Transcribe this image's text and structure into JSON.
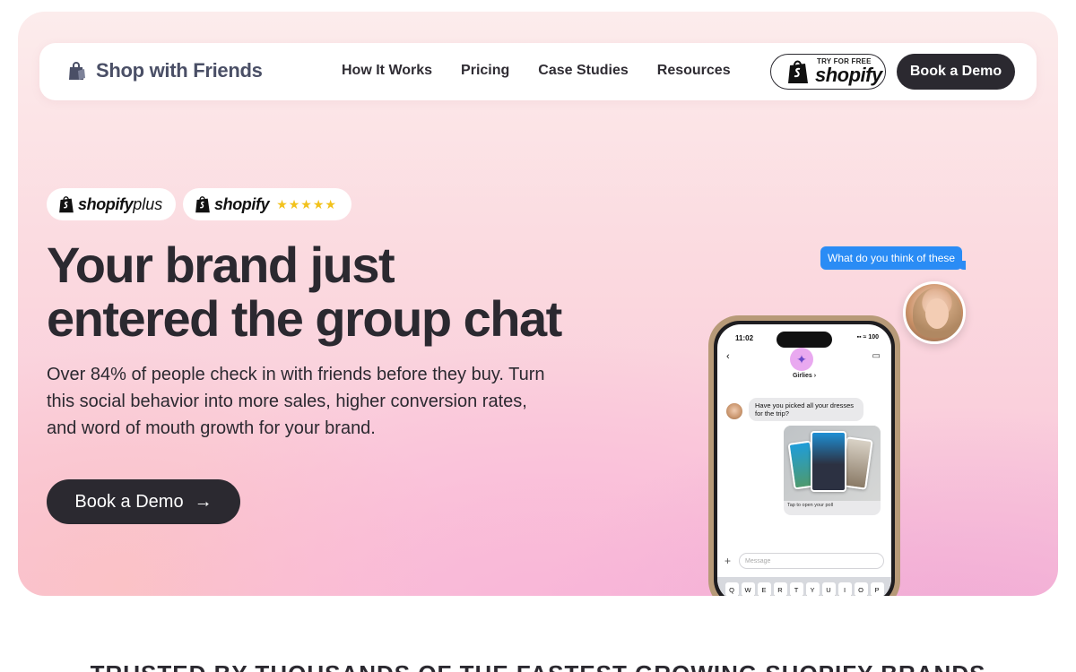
{
  "nav": {
    "brand": "Shop with Friends",
    "links": [
      "How It Works",
      "Pricing",
      "Case Studies",
      "Resources"
    ],
    "shopify_try_small": "TRY FOR FREE",
    "shopify_try_word": "shopify",
    "demo_label": "Book a Demo"
  },
  "badges": {
    "plus_word": "shopify",
    "plus_suffix": "plus",
    "shopify_word": "shopify",
    "stars": "★★★★★",
    "star_rating": 5
  },
  "hero": {
    "headline_line1": "Your brand just",
    "headline_line2": "entered the group chat",
    "subtext": "Over 84% of people check in with friends before they buy. Turn this social behavior into more sales, higher conversion rates, and word of mouth growth for your brand.",
    "cta_label": "Book a Demo",
    "cta_arrow": "→"
  },
  "phone": {
    "floating_bubble": "What do you think of these",
    "time": "11:02",
    "status": "▪▪ ≈ 100",
    "group_name": "Girlies ›",
    "message": "Have you picked all your dresses for the trip?",
    "media_caption": "Tap to open your poll",
    "input_placeholder": "Message",
    "keyboard_row": [
      "Q",
      "W",
      "E",
      "R",
      "T",
      "Y",
      "U",
      "I",
      "O",
      "P"
    ]
  },
  "trusted": {
    "label": "TRUSTED BY THOUSANDS OF THE FASTEST GROWING SHOPIFY BRANDS"
  },
  "colors": {
    "dark": "#2b2930",
    "brand_text": "#4a4f66",
    "imessage_blue": "#2a8cf5",
    "star_yellow": "#f2c21c"
  }
}
